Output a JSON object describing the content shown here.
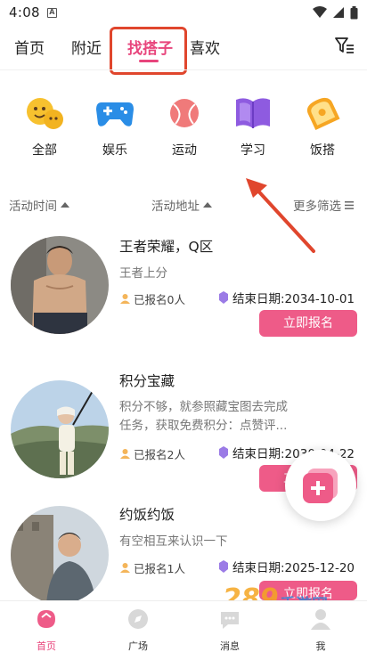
{
  "status_bar": {
    "time": "4:08",
    "notif": "A"
  },
  "top_nav": {
    "tabs": [
      {
        "label": "首页"
      },
      {
        "label": "附近"
      },
      {
        "label": "找搭子"
      },
      {
        "label": "喜欢"
      }
    ],
    "active_tab": "找搭子"
  },
  "categories": [
    {
      "label": "全部",
      "icon": "emoji-icon"
    },
    {
      "label": "娱乐",
      "icon": "gamepad-icon"
    },
    {
      "label": "运动",
      "icon": "ball-icon"
    },
    {
      "label": "学习",
      "icon": "book-icon"
    },
    {
      "label": "饭搭",
      "icon": "toast-icon"
    }
  ],
  "sort_bar": {
    "time": "活动时间",
    "location": "活动地址",
    "more": "更多筛选"
  },
  "activities": [
    {
      "title": "王者荣耀，Q区",
      "desc_lines": [
        "王者上分"
      ],
      "joined": "已报名0人",
      "end_date": "结束日期:2034-10-01",
      "button": "立即报名"
    },
    {
      "title": "积分宝藏",
      "desc_lines": [
        "积分不够，就参照藏宝图去完成",
        "任务，获取免费积分：点赞评..."
      ],
      "joined": "已报名2人",
      "end_date": "结束日期:2030-04-22",
      "button": "立即报名"
    },
    {
      "title": "约饭约饭",
      "desc_lines": [
        "有空相互来认识一下"
      ],
      "joined": "已报名1人",
      "end_date": "结束日期:2025-12-20",
      "button": "立即报名"
    }
  ],
  "bottom_nav": [
    {
      "label": "首页",
      "icon": "home-icon"
    },
    {
      "label": "广场",
      "icon": "compass-icon"
    },
    {
      "label": "消息",
      "icon": "chat-icon"
    },
    {
      "label": "我",
      "icon": "profile-icon"
    }
  ],
  "watermark": "289手游网",
  "colors": {
    "accent": "#e8457c",
    "button": "#ee5b88",
    "annotation": "#e0462d"
  }
}
